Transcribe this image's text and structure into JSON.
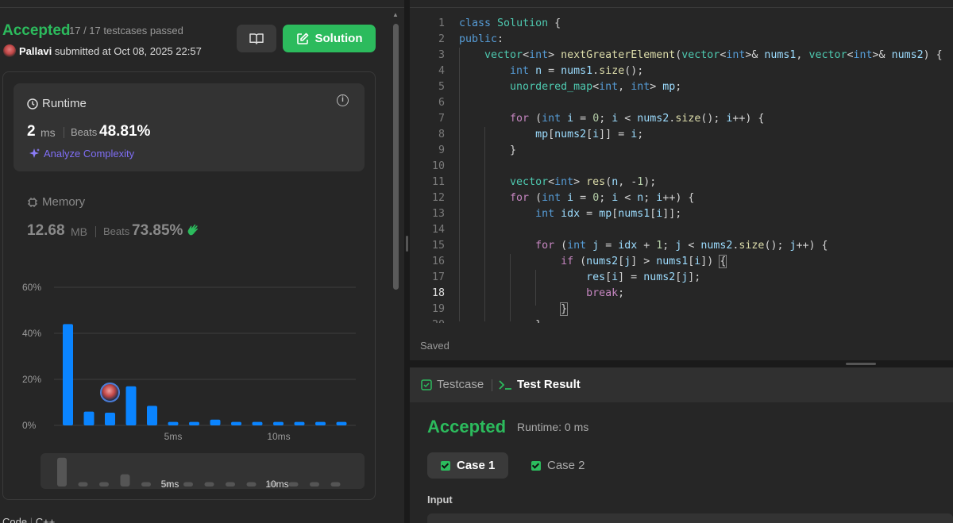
{
  "submission": {
    "status": "Accepted",
    "testcases": "17 / 17 testcases passed",
    "user": "Pallavi",
    "submitted": "submitted at Oct 08, 2025 22:57",
    "solution_label": "Solution"
  },
  "runtime": {
    "title": "Runtime",
    "value": "2",
    "unit": "ms",
    "beats_label": "Beats",
    "beats": "48.81%",
    "analyze": "Analyze Complexity"
  },
  "memory": {
    "title": "Memory",
    "value": "12.68",
    "unit": "MB",
    "beats_label": "Beats",
    "beats": "73.85%"
  },
  "chart_data": {
    "type": "bar",
    "y_ticks": [
      "60%",
      "40%",
      "20%",
      "0%"
    ],
    "x_ticks": [
      "5ms",
      "10ms"
    ],
    "ylim": [
      0,
      60
    ],
    "values": [
      44,
      6,
      5.5,
      17,
      8.5,
      1.5,
      1.5,
      2.5,
      1.5,
      1.5,
      1.5,
      1.5,
      1.5,
      1.5
    ],
    "highlight_index": 2,
    "color": "#0a84ff"
  },
  "mini_chart": {
    "values": [
      33,
      5,
      5,
      14,
      5,
      5,
      5,
      5,
      5,
      5,
      5,
      5,
      5,
      5
    ],
    "x_ticks": [
      "5ms",
      "10ms"
    ]
  },
  "bottom": {
    "code_label": "Code",
    "lang": "C++"
  },
  "editor": {
    "saved": "Saved",
    "current_line": 18
  },
  "result": {
    "tab_testcase": "Testcase",
    "tab_result": "Test Result",
    "status": "Accepted",
    "runtime": "Runtime: 0 ms",
    "cases": [
      "Case 1",
      "Case 2"
    ],
    "input_label": "Input"
  }
}
